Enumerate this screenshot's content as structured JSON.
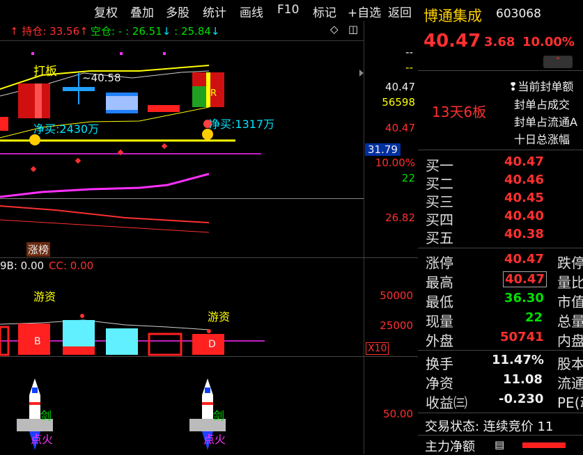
{
  "menu": [
    "复权",
    "叠加",
    "多股",
    "统计",
    "画线",
    "F10",
    "标记",
    "+自选",
    "返回"
  ],
  "chart_header": {
    "hold_label": "持仓: 33.56",
    "empty_label": "空仓: - : 26.51",
    "empty_label2": ": 25.84"
  },
  "price_scale": {
    "top1": "--",
    "top2": "--",
    "v1": "40.47",
    "v2": "56598",
    "v3": "40.47",
    "v4": "31.79",
    "v5": "10.00%",
    "v6": "22",
    "v7": "26.82"
  },
  "annotations": {
    "daban": "打板",
    "price_mark": "40.58",
    "net_buy1": "净买:2430万",
    "net_buy2": "净买:1317万",
    "r_mark": "R",
    "zhangbang": "涨榜"
  },
  "indicator": {
    "bb_text": "9B: 0.00",
    "cc_text": "CC: 0.00",
    "youzi1": "游资",
    "youzi2": "游资",
    "b_label": "B",
    "d_label": "D",
    "scale_50000": "50000",
    "scale_25000": "25000",
    "x10": "X10"
  },
  "bottom": {
    "jian1": "剑",
    "jian2": "剑",
    "dianhuo1": "点火",
    "dianhuo2": "点火",
    "scale": "50.00"
  },
  "stock": {
    "name": "博通集成",
    "code": "603068",
    "price": "40.47",
    "change": "3.68",
    "pct": "10.00%",
    "streak": "13天6板",
    "info1": "当前封单额",
    "info2": "封单占成交",
    "info3": "封单占流通A",
    "info4": "十日总涨幅"
  },
  "order_book": [
    {
      "label": "买一",
      "value": "40.47"
    },
    {
      "label": "买二",
      "value": "40.46"
    },
    {
      "label": "买三",
      "value": "40.45"
    },
    {
      "label": "买四",
      "value": "40.40"
    },
    {
      "label": "买五",
      "value": "40.38"
    }
  ],
  "stats": [
    {
      "label": "涨停",
      "value": "40.47",
      "right": "跌停",
      "color": "#ff3030"
    },
    {
      "label": "最高",
      "value": "40.47",
      "right": "量比",
      "color": "#ff3030"
    },
    {
      "label": "最低",
      "value": "36.30",
      "right": "市值",
      "color": "#00e000"
    },
    {
      "label": "现量",
      "value": "22",
      "right": "总量",
      "color": "#00e000"
    },
    {
      "label": "外盘",
      "value": "50741",
      "right": "内盘",
      "color": "#ff3030"
    }
  ],
  "stats2": [
    {
      "label": "换手",
      "value": "11.47%",
      "right": "股本"
    },
    {
      "label": "净资",
      "value": "11.08",
      "right": "流通"
    },
    {
      "label": "收益㈢",
      "value": "-0.230",
      "right": "PE(动"
    }
  ],
  "trade_status": "交易状态: 连续竞价 11",
  "main_flow": "主力净额"
}
